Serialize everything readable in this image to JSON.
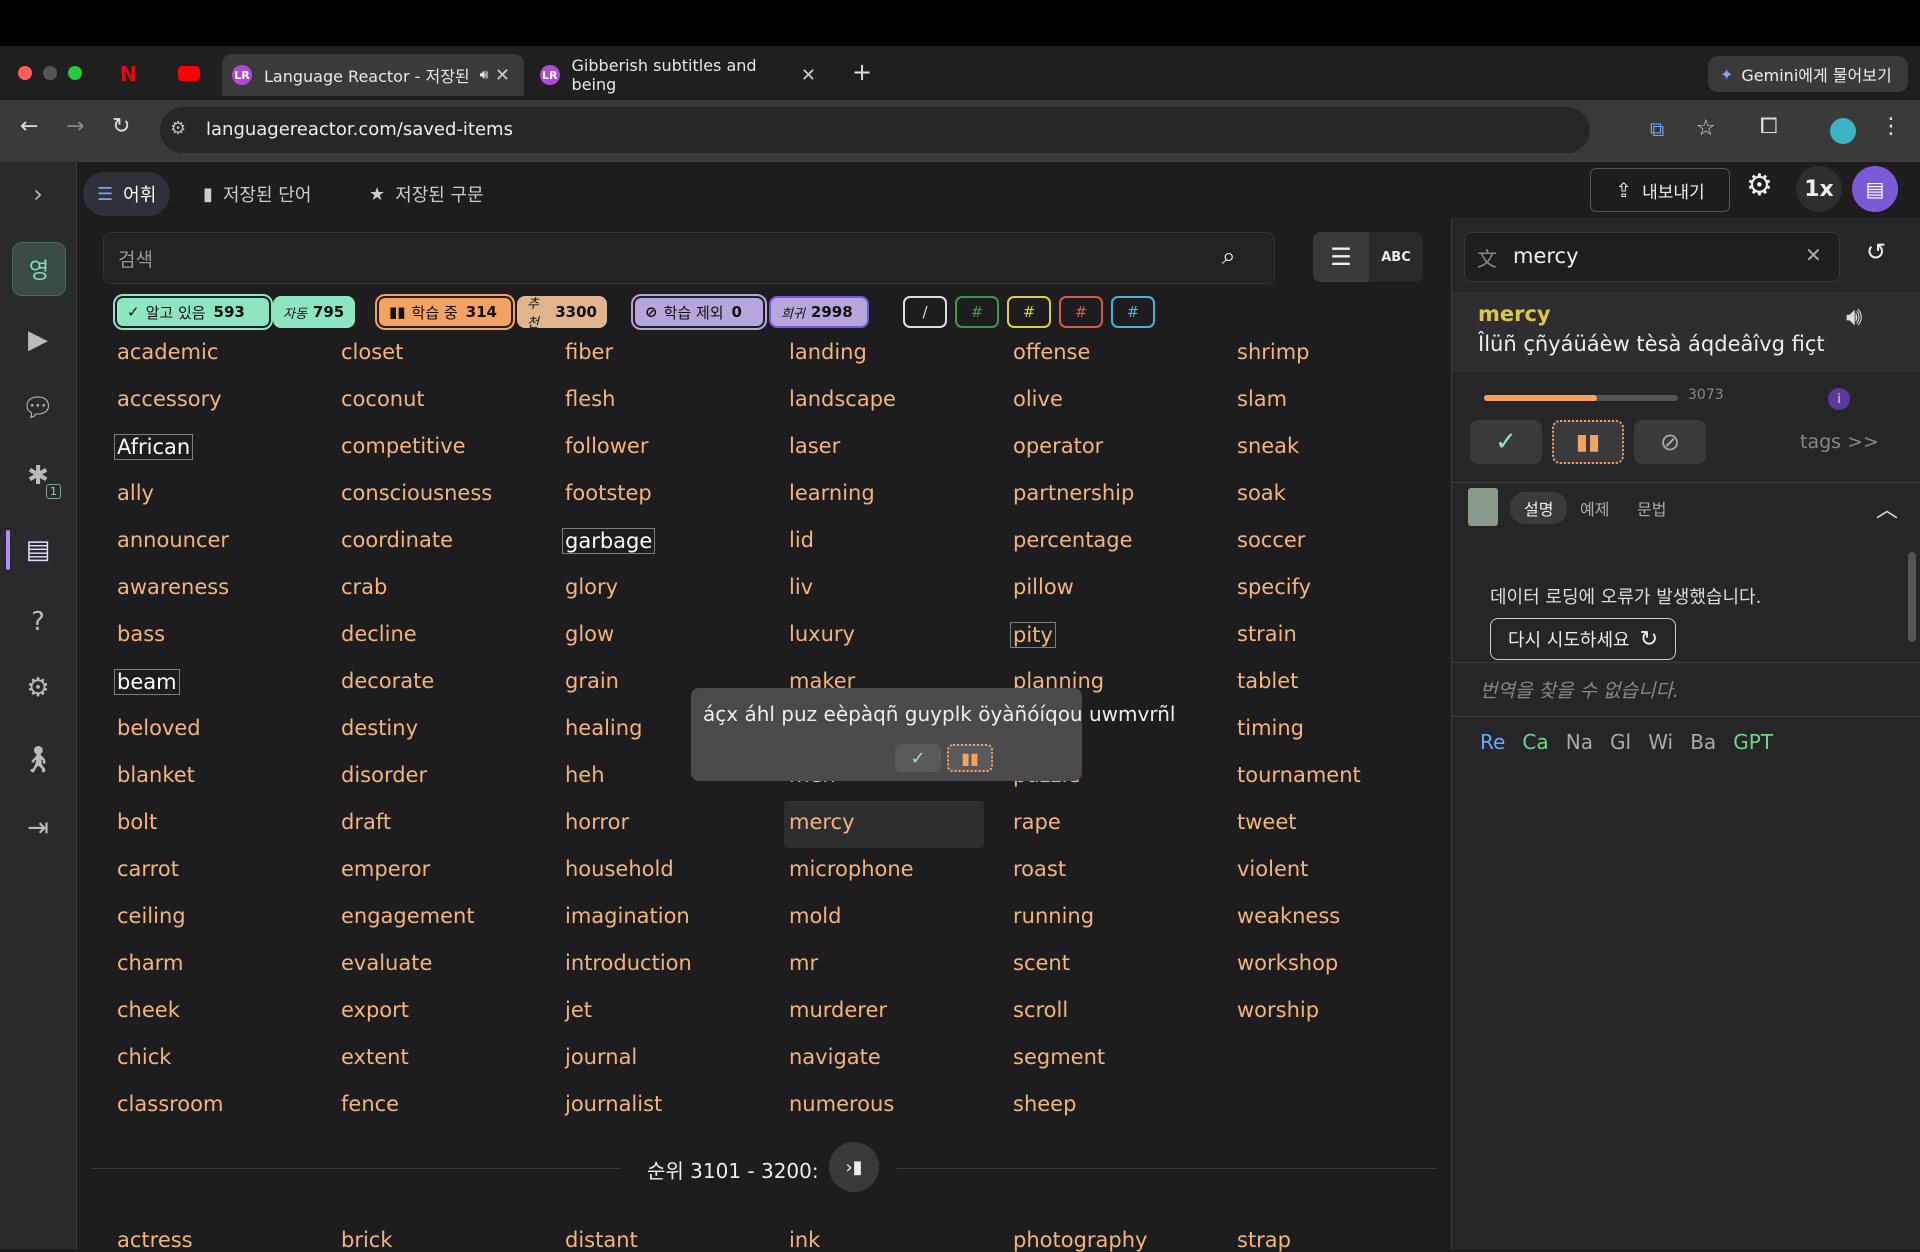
{
  "browser": {
    "tabs": [
      {
        "label": "Language Reactor - 저장된",
        "active": true
      },
      {
        "label": "Gibberish subtitles and being",
        "active": false
      }
    ],
    "new_tab_label": "+",
    "gemini_label": "Gemini에게 물어보기",
    "url": "languagereactor.com/saved-items"
  },
  "rail": {
    "language_badge": "영",
    "badge_count": "1"
  },
  "topnav": {
    "vocab": "어휘",
    "saved_words": "저장된 단어",
    "saved_phrases": "저장된 구문",
    "export": "내보내기",
    "speed": "1x"
  },
  "search": {
    "placeholder": "검색",
    "abc": "ABC"
  },
  "chips": {
    "known_label": "알고 있음",
    "known_count": "593",
    "auto_label": "자동",
    "auto_count": "795",
    "learning_label": "학습 중",
    "learning_count": "314",
    "recommended_label": "추천",
    "recommended_count": "3300",
    "excluded_label": "학습 제외",
    "excluded_count": "0",
    "rare_label": "희귀",
    "rare_count": "2998",
    "tags": [
      "/",
      "#",
      "#",
      "#",
      "#"
    ]
  },
  "columns": [
    [
      "academic",
      "accessory",
      "African",
      "ally",
      "announcer",
      "awareness",
      "bass",
      "beam",
      "beloved",
      "blanket",
      "bolt",
      "carrot",
      "ceiling",
      "charm",
      "cheek",
      "chick",
      "classroom"
    ],
    [
      "closet",
      "coconut",
      "competitive",
      "consciousness",
      "coordinate",
      "crab",
      "decline",
      "decorate",
      "destiny",
      "disorder",
      "draft",
      "emperor",
      "engagement",
      "evaluate",
      "export",
      "extent",
      "fence"
    ],
    [
      "fiber",
      "flesh",
      "follower",
      "footstep",
      "garbage",
      "glory",
      "glow",
      "grain",
      "healing",
      "heh",
      "horror",
      "household",
      "imagination",
      "introduction",
      "jet",
      "journal",
      "journalist"
    ],
    [
      "landing",
      "landscape",
      "laser",
      "learning",
      "lid",
      "liv",
      "luxury",
      "maker",
      "",
      "men",
      "mercy",
      "microphone",
      "mold",
      "mr",
      "murderer",
      "navigate",
      "numerous"
    ],
    [
      "offense",
      "olive",
      "operator",
      "partnership",
      "percentage",
      "pillow",
      "pity",
      "planning",
      "",
      "puzzle",
      "rape",
      "roast",
      "running",
      "scent",
      "scroll",
      "segment",
      "sheep"
    ],
    [
      "shrimp",
      "slam",
      "sneak",
      "soak",
      "soccer",
      "specify",
      "strain",
      "tablet",
      "timing",
      "tournament",
      "tweet",
      "violent",
      "weakness",
      "workshop",
      "worship",
      "",
      ""
    ]
  ],
  "boxed_words": [
    "African",
    "beam",
    "garbage",
    "pity"
  ],
  "white_words": [
    "African",
    "beam",
    "garbage"
  ],
  "tooltip": {
    "text": "áçx áhl puz eèpàqñ guyplk öyàñóíqou uwmvrñl"
  },
  "range": {
    "label": "순위 3101 - 3200:"
  },
  "next_row": [
    "actress",
    "brick",
    "distant",
    "ink",
    "photography",
    "strap"
  ],
  "right": {
    "search_value": "mercy",
    "word": "mercy",
    "gloss": "Îlüñ çñyáüáèw tèsà áqdeâîvg fiçt",
    "freq": "3073",
    "progress": 0.58,
    "tags_link": "tags >>",
    "tabs": [
      "설명",
      "예제",
      "문법"
    ],
    "error": "데이터 로딩에 오류가 발생했습니다.",
    "retry": "다시 시도하세요",
    "no_translation": "번역을 찾을 수 없습니다.",
    "links": [
      "Re",
      "Ca",
      "Na",
      "Gl",
      "Wi",
      "Ba",
      "GPT"
    ]
  }
}
